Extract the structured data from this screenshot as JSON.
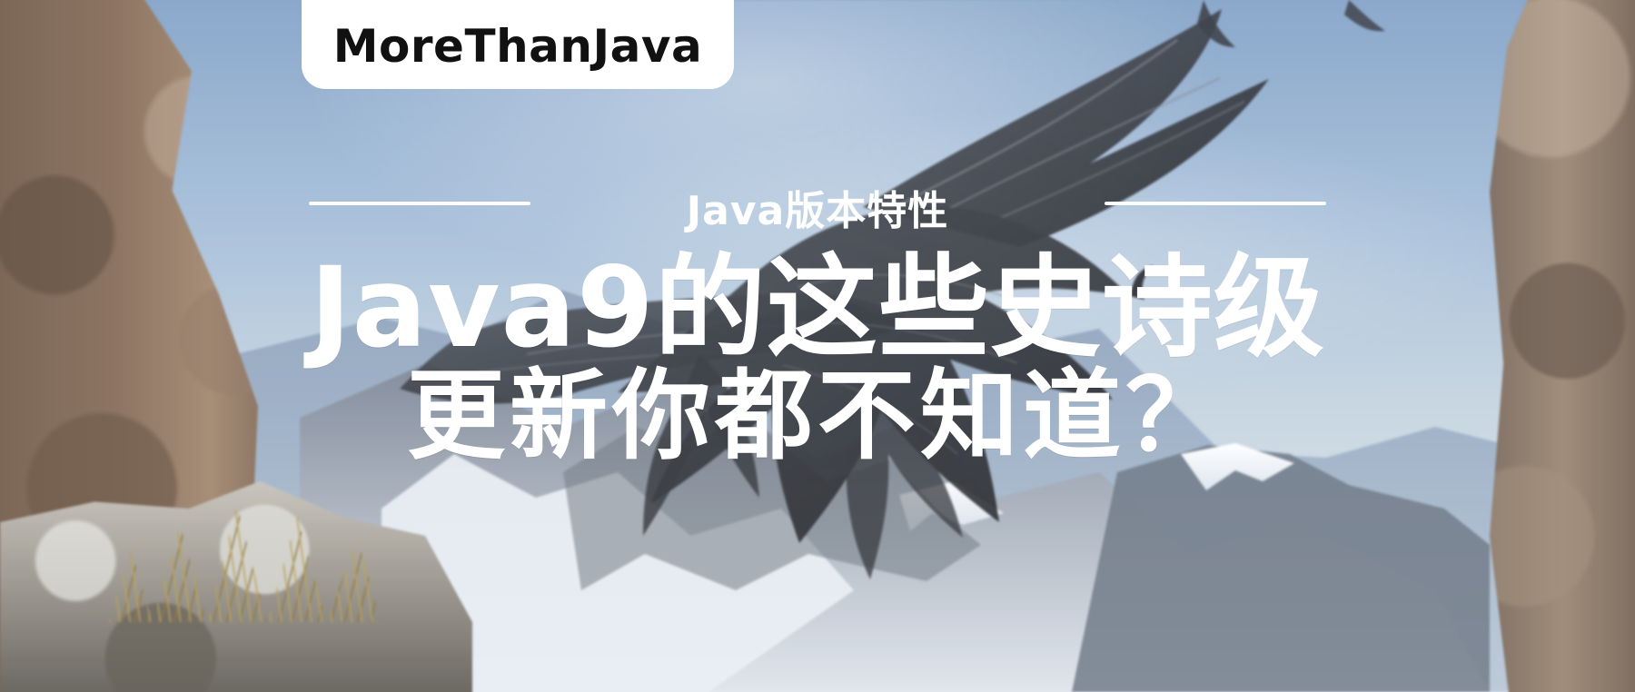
{
  "brand": {
    "label": "MoreThanJava"
  },
  "subtitle": {
    "label": "Java版本特性"
  },
  "headline": {
    "line1": "Java9的这些史诗级",
    "line2": "更新你都不知道？"
  },
  "colors": {
    "text": "#ffffff",
    "badge_bg": "#ffffff",
    "badge_text": "#111111"
  },
  "icons": {
    "hero": "crow-in-flight-illustration"
  }
}
